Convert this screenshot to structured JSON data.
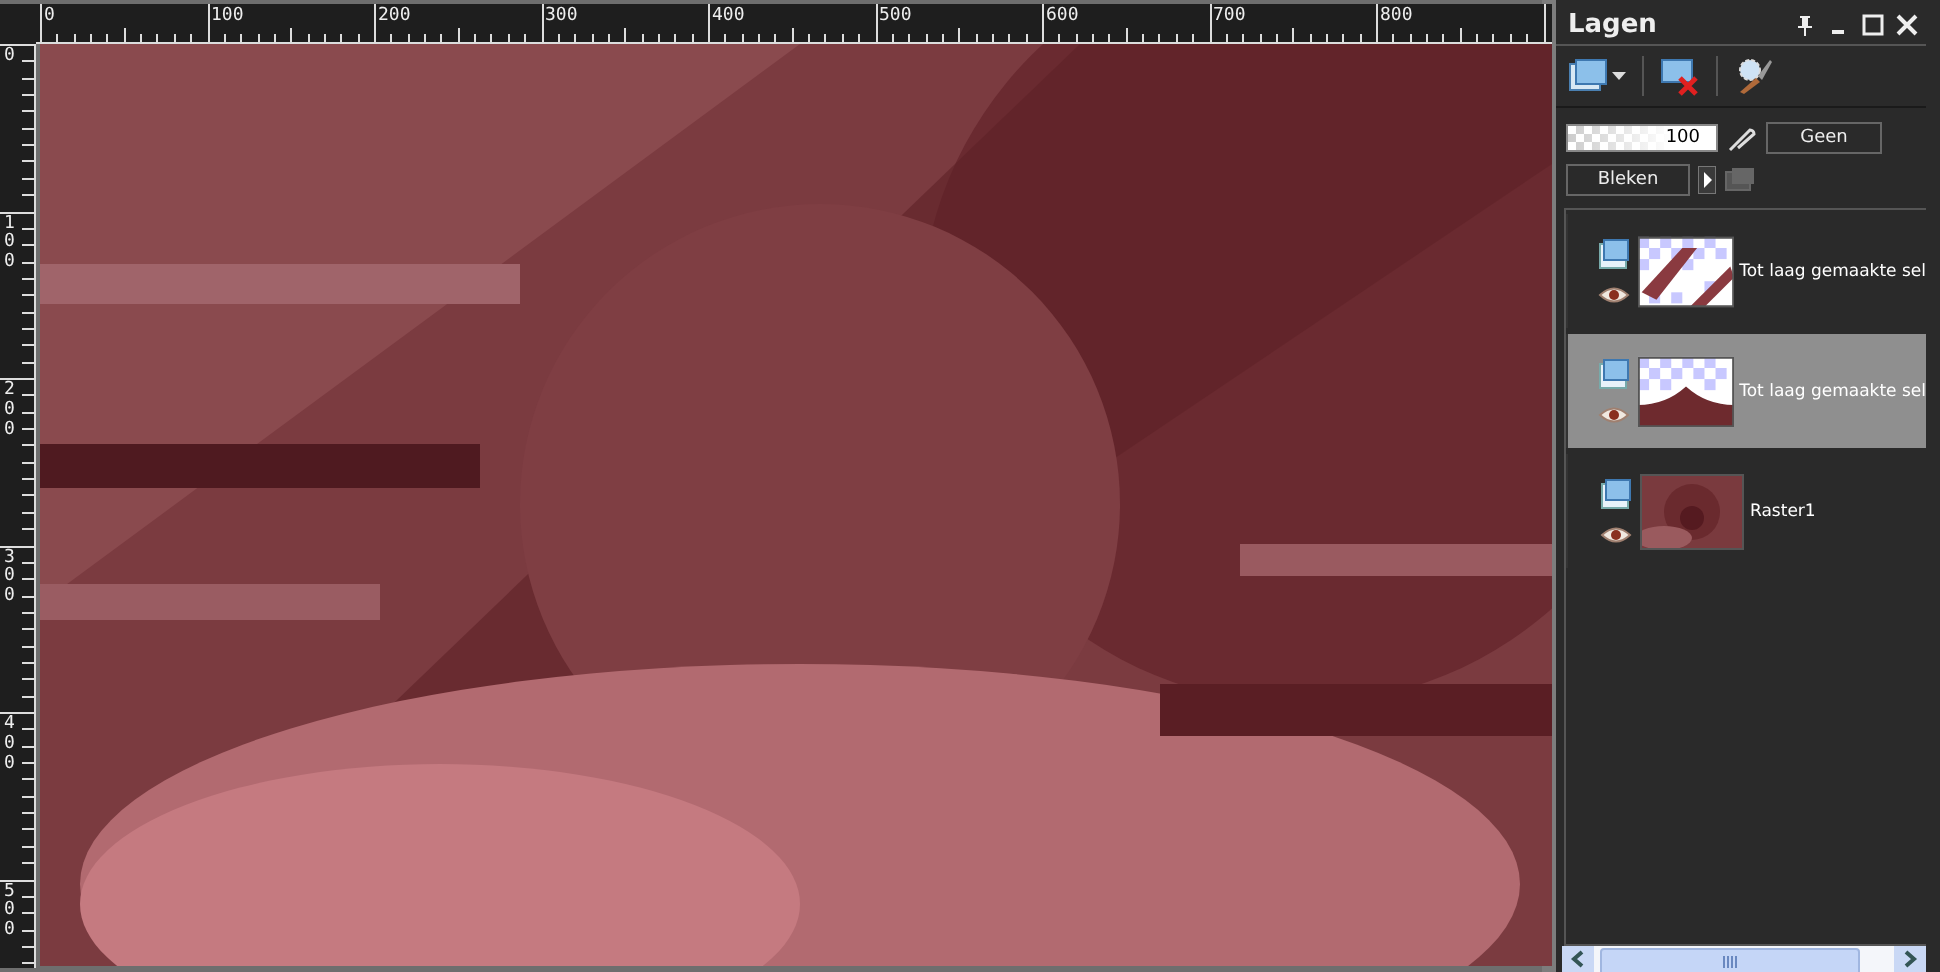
{
  "rulers": {
    "horizontal": [
      "0",
      "100",
      "200",
      "300",
      "400",
      "500",
      "600",
      "700",
      "800"
    ],
    "vertical": [
      "0",
      "100",
      "200",
      "300",
      "400",
      "500"
    ]
  },
  "layers_panel": {
    "title": "Lagen",
    "opacity": "100",
    "mask": "Geen",
    "blend_mode": "Bleken",
    "layers": [
      {
        "name": "Tot laag gemaakte sel",
        "kind": "stripes",
        "selected": false,
        "visible": true
      },
      {
        "name": "Tot laag gemaakte sel",
        "kind": "wave",
        "selected": true,
        "visible": true
      },
      {
        "name": "Raster1",
        "kind": "raster",
        "selected": false,
        "visible": true
      }
    ]
  }
}
